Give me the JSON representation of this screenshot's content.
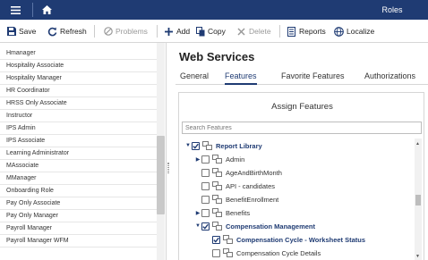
{
  "header": {
    "title": "Roles",
    "menu_icon": "hamburger-icon",
    "home_icon": "home-icon"
  },
  "toolbar": {
    "save": "Save",
    "refresh": "Refresh",
    "problems": "Problems",
    "add": "Add",
    "copy": "Copy",
    "delete": "Delete",
    "reports": "Reports",
    "localize": "Localize"
  },
  "roles_list": {
    "items": [
      "Hmanager",
      "Hospitality Associate",
      "Hospitality Manager",
      "HR Coordinator",
      "HRSS Only Associate",
      "Instructor",
      "IPS Admin",
      "IPS Associate",
      "Learning Administrator",
      "MAssociate",
      "MManager",
      "Onboarding Role",
      "Pay Only Associate",
      "Pay Only Manager",
      "Payroll Manager",
      "Payroll Manager WFM"
    ]
  },
  "main": {
    "title": "Web Services",
    "tabs": [
      "General",
      "Features",
      "Favorite Features",
      "Authorizations"
    ],
    "active_tab": "Features"
  },
  "features": {
    "heading": "Assign Features",
    "search_placeholder": "Search Features",
    "tree": [
      {
        "label": "Report Library",
        "checked": true,
        "expanded": true,
        "bold": true
      },
      {
        "label": "Admin",
        "checked": false,
        "expanded": false,
        "bold": false
      },
      {
        "label": "AgeAndBirthMonth",
        "checked": false,
        "bold": false
      },
      {
        "label": "API - candidates",
        "checked": false,
        "bold": false
      },
      {
        "label": "BenefitEnrollment",
        "checked": false,
        "bold": false
      },
      {
        "label": "Benefits",
        "checked": false,
        "expanded": false,
        "bold": false
      },
      {
        "label": "Compensation Management",
        "checked": true,
        "expanded": true,
        "bold": true
      },
      {
        "label": "Compensation Cycle - Worksheet Status",
        "checked": true,
        "bold": true
      },
      {
        "label": "Compensation Cycle Details",
        "checked": false,
        "bold": false
      }
    ]
  },
  "colors": {
    "header_bg": "#1f3b73",
    "accent": "#1f3b73"
  }
}
